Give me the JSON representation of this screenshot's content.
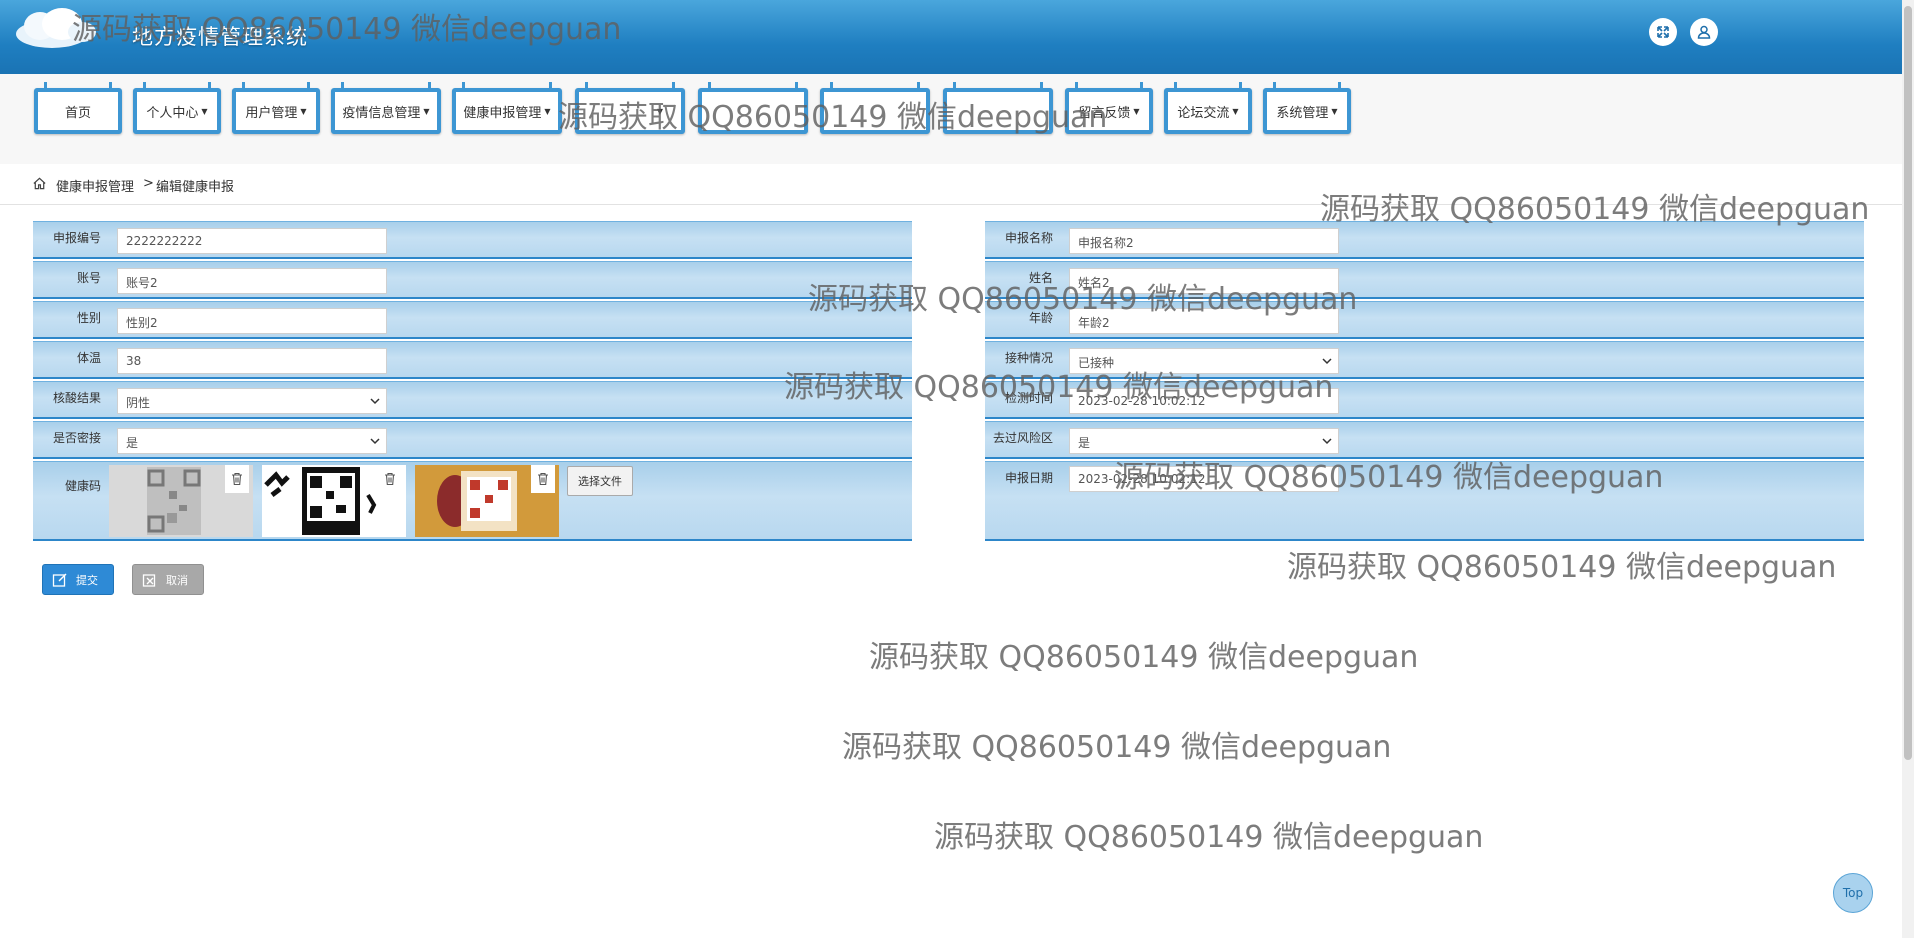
{
  "header": {
    "title": "地方疫情管理系统",
    "icons": [
      "expand-icon",
      "user-icon"
    ]
  },
  "nav": [
    {
      "label": "首页",
      "dropdown": false
    },
    {
      "label": "个人中心",
      "dropdown": true
    },
    {
      "label": "用户管理",
      "dropdown": true
    },
    {
      "label": "疫情信息管理",
      "dropdown": true
    },
    {
      "label": "健康申报管理",
      "dropdown": true
    },
    {
      "label": "",
      "dropdown": true
    },
    {
      "label": "",
      "dropdown": false
    },
    {
      "label": "",
      "dropdown": false
    },
    {
      "label": "",
      "dropdown": false
    },
    {
      "label": "留言反馈",
      "dropdown": true
    },
    {
      "label": "论坛交流",
      "dropdown": true
    },
    {
      "label": "系统管理",
      "dropdown": true
    }
  ],
  "breadcrumb": {
    "section": "健康申报管理",
    "separator": ">",
    "page": "编辑健康申报"
  },
  "form": {
    "report_no": {
      "label": "申报编号",
      "value": "2222222222"
    },
    "report_name": {
      "label": "申报名称",
      "value": "申报名称2"
    },
    "account": {
      "label": "账号",
      "value": "账号2"
    },
    "name": {
      "label": "姓名",
      "value": "姓名2"
    },
    "gender": {
      "label": "性别",
      "value": "性别2"
    },
    "age": {
      "label": "年龄",
      "value": "年龄2"
    },
    "temperature": {
      "label": "体温",
      "value": "38"
    },
    "vaccination": {
      "label": "接种情况",
      "value": "已接种"
    },
    "nucleic_result": {
      "label": "核酸结果",
      "value": "阴性"
    },
    "test_time": {
      "label": "检测时间",
      "value": "2023-02-28 10:02:12"
    },
    "close_contact": {
      "label": "是否密接",
      "value": "是"
    },
    "risk_area": {
      "label": "去过风险区",
      "value": "是"
    },
    "health_code": {
      "label": "健康码",
      "file_button": "选择文件"
    },
    "report_date": {
      "label": "申报日期",
      "value": "2023-02-28 10:02:12"
    }
  },
  "actions": {
    "submit": "提交",
    "cancel": "取消"
  },
  "top_button": "Top",
  "watermark": "源码获取 QQ86050149 微信deepguan",
  "colors": {
    "header": "#1f7fc1",
    "row": "#b8d8ef",
    "submit": "#2e8ad6",
    "cancel": "#a8a8a8"
  }
}
